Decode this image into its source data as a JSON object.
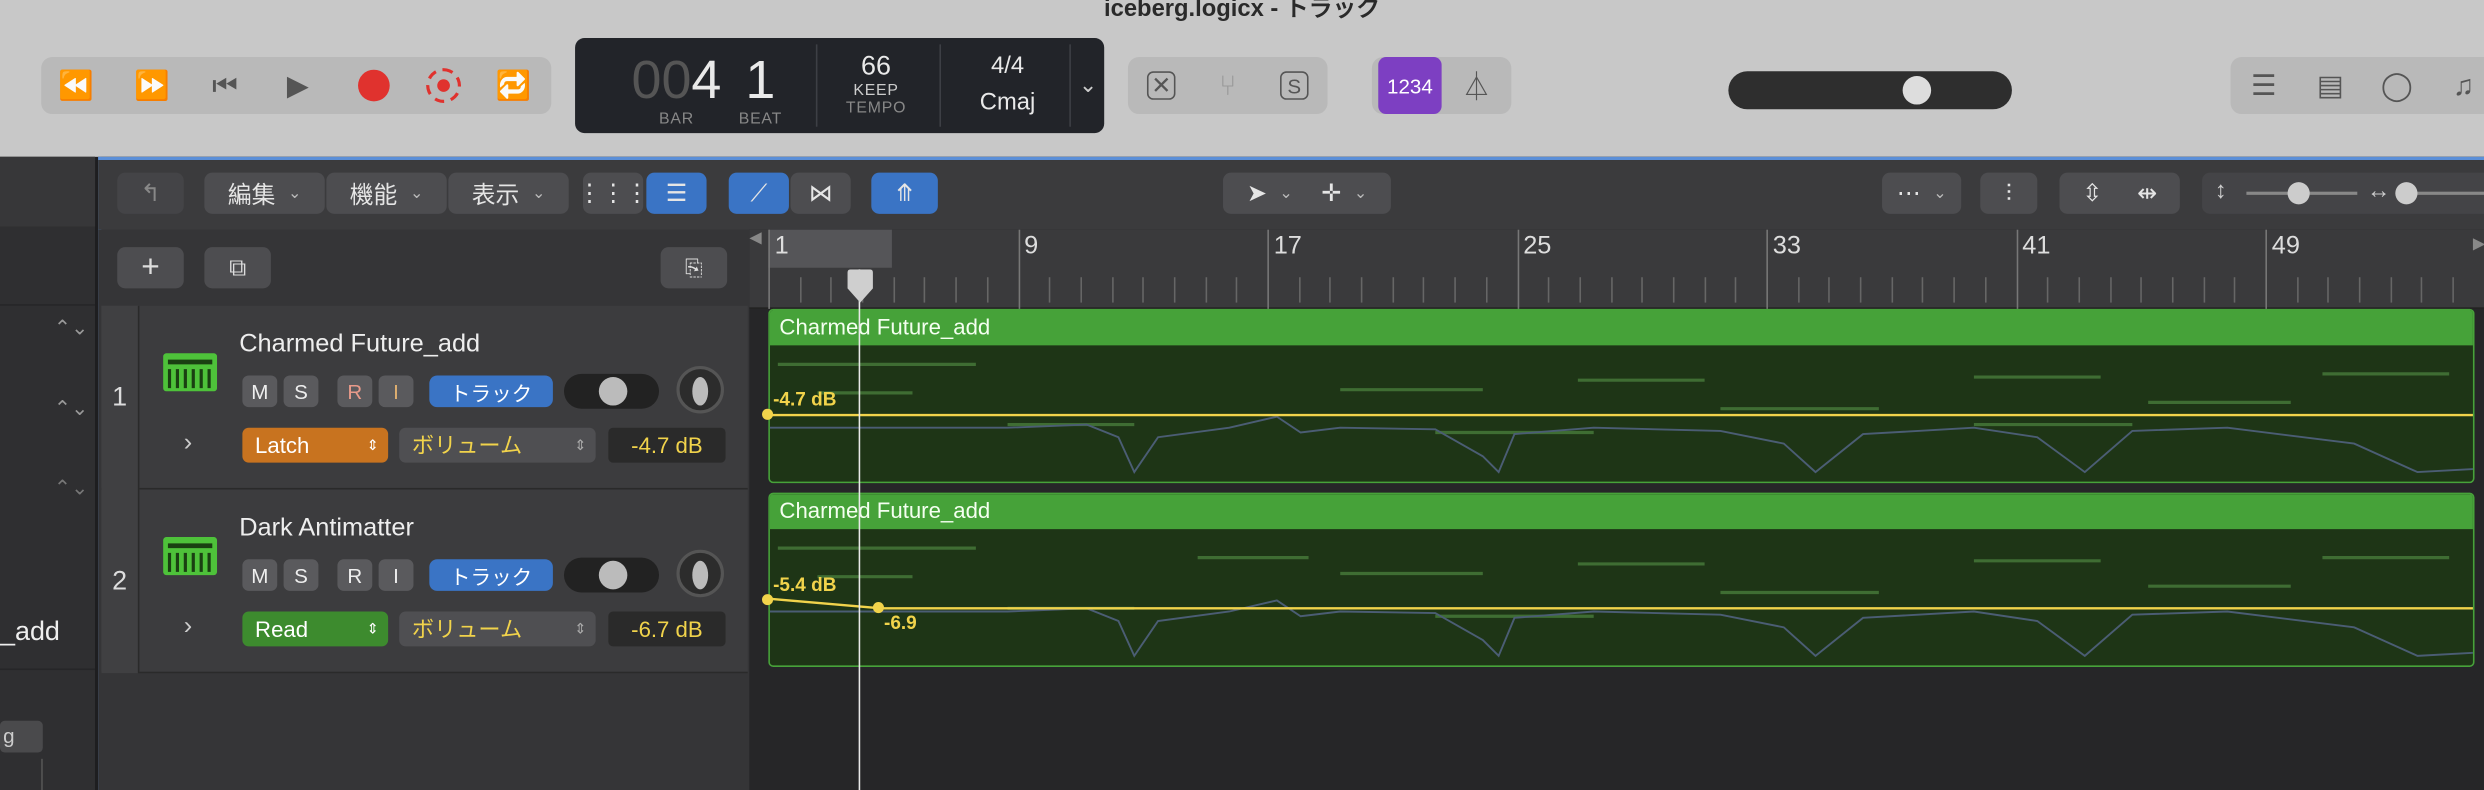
{
  "window": {
    "title": "iceberg.logicx - トラック"
  },
  "lcd": {
    "bar_prefix": "00",
    "bar": "4",
    "beat": "1",
    "bar_label": "BAR",
    "beat_label": "BEAT",
    "tempo": "66",
    "tempo_mode": "KEEP",
    "tempo_label": "TEMPO",
    "signature": "4/4",
    "key": "Cmaj"
  },
  "count_in": {
    "label": "1234"
  },
  "toolbar": {
    "edit_menu": "編集",
    "function_menu": "機能",
    "view_menu": "表示"
  },
  "ruler": {
    "marks": [
      "1",
      "9",
      "17",
      "25",
      "33",
      "41",
      "49"
    ]
  },
  "inspector": {
    "partial_text": "_add",
    "partial_button": "g"
  },
  "tracks": [
    {
      "number": "1",
      "name": "Charmed Future_add",
      "mute": "M",
      "solo": "S",
      "record": "R",
      "input": "I",
      "track_button": "トラック",
      "automation_mode": "Latch",
      "automation_param": "ボリューム",
      "volume": "-4.7 dB",
      "region_name": "Charmed Future_add",
      "region_db_label": "-4.7 dB"
    },
    {
      "number": "2",
      "name": "Dark Antimatter",
      "mute": "M",
      "solo": "S",
      "record": "R",
      "input": "I",
      "track_button": "トラック",
      "automation_mode": "Read",
      "automation_param": "ボリューム",
      "volume": "-6.7 dB",
      "region_name": "Charmed Future_add",
      "region_db_label": "-5.4 dB",
      "region_point_label": "-6.9"
    }
  ],
  "colors": {
    "accent_blue": "#3a74c5",
    "region_green": "#46a239",
    "automation_yellow": "#f1d34b",
    "latch_orange": "#c8731f",
    "read_green": "#3d8b2e",
    "record_red": "#e0322e",
    "count_in_purple": "#7d3fc2"
  }
}
